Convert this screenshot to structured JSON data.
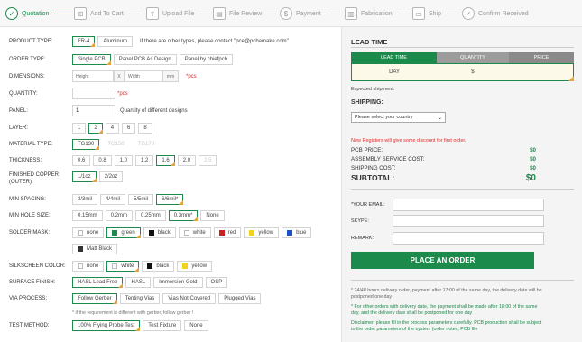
{
  "colors": {
    "brand": "#1b8a4b",
    "accent": "#e6a23c",
    "alert": "#e32b2b"
  },
  "steps": [
    {
      "label": "Quotation",
      "icon": "check-circle-icon",
      "active": true
    },
    {
      "label": "Add To Cart",
      "icon": "cart-icon",
      "active": false
    },
    {
      "label": "Upload File",
      "icon": "upload-icon",
      "active": false
    },
    {
      "label": "File Review",
      "icon": "file-icon",
      "active": false
    },
    {
      "label": "Payment",
      "icon": "dollar-icon",
      "active": false
    },
    {
      "label": "Fabrication",
      "icon": "factory-icon",
      "active": false
    },
    {
      "label": "Ship",
      "icon": "truck-icon",
      "active": false
    },
    {
      "label": "Confirm Received",
      "icon": "check-icon",
      "active": false
    }
  ],
  "form": {
    "product_type": {
      "label": "PRODUCT TYPE:",
      "options": [
        "FR-4",
        "Aluminum"
      ],
      "note": "If there are other types, please contact \"pce@pcbamake.com\""
    },
    "order_type": {
      "label": "ORDER TYPE:",
      "options": [
        "Single PCB",
        "Panel PCB As Design",
        "Panel by chiefpcb"
      ]
    },
    "dimensions": {
      "label": "DIMENSIONS:",
      "height_placeholder": "Height",
      "x": "X",
      "width_placeholder": "Width",
      "unit": "mm",
      "note": "*pcs"
    },
    "quantity": {
      "label": "QUANTITY:",
      "note": "*pcs"
    },
    "panel": {
      "label": "PANEL:",
      "value": "1",
      "note": "Quantity of different designs"
    },
    "layer": {
      "label": "LAYER:",
      "options": [
        "1",
        "2",
        "4",
        "6",
        "8"
      ]
    },
    "material_type": {
      "label": "MATERIAL TYPE:",
      "options": [
        "TG130",
        "TG150",
        "TG170"
      ]
    },
    "thickness": {
      "label": "THICKNESS:",
      "options": [
        "0.6",
        "0.8",
        "1.0",
        "1.2",
        "1.6",
        "2.0",
        "2.5"
      ]
    },
    "finished_copper": {
      "label": "FINISHED COPPER (OUTER):",
      "label1": "FINISHED COPPER",
      "label2": "(OUTER):",
      "options": [
        "1/1oz",
        "2/2oz"
      ]
    },
    "min_spacing": {
      "label": "MIN SPACING:",
      "options": [
        "3/3mil",
        "4/4mil",
        "5/5mil",
        "6/6mil*"
      ]
    },
    "min_hole_size": {
      "label": "MIN HOLE SIZE:",
      "options": [
        "0.15mm",
        "0.2mm",
        "0.25mm",
        "0.3mm*",
        "None"
      ]
    },
    "solder_mask": {
      "label": "SOLDER MASK:",
      "options": [
        {
          "name": "none",
          "color": "#ffffff"
        },
        {
          "name": "green",
          "color": "#1b8a4b"
        },
        {
          "name": "black",
          "color": "#111111"
        },
        {
          "name": "white",
          "color": "#ffffff"
        },
        {
          "name": "red",
          "color": "#cc1f1f"
        },
        {
          "name": "yellow",
          "color": "#f2d21b"
        },
        {
          "name": "blue",
          "color": "#1f4fcc"
        },
        {
          "name": "Matt Black",
          "color": "#333333"
        }
      ]
    },
    "silkscreen": {
      "label": "SILKSCREEN COLOR:",
      "options": [
        {
          "name": "none",
          "color": "#ffffff"
        },
        {
          "name": "white",
          "color": "#ffffff"
        },
        {
          "name": "black",
          "color": "#111111"
        },
        {
          "name": "yellow",
          "color": "#f2d21b"
        }
      ]
    },
    "surface_finish": {
      "label": "SURFACE FINISH:",
      "options": [
        "HASL Lead Free",
        "HASL",
        "Immersion Gold",
        "OSP"
      ]
    },
    "via_process": {
      "label": "VIA PROCESS:",
      "options": [
        "Follow Gerber",
        "Tenting Vias",
        "Vias Not Covered",
        "Plugged Vias"
      ],
      "note": "* if the requirement is different with gerber, follow gerber !"
    },
    "test_method": {
      "label": "TEST METHOD:",
      "options": [
        "100% Flying Probe Test",
        "Test Fixture",
        "None"
      ]
    }
  },
  "panel": {
    "lead_time_title": "LEAD TIME",
    "table_headers": [
      "LEAD TIME",
      "QUANTITY",
      "PRICE"
    ],
    "table_row": [
      "DAY",
      "$",
      ""
    ],
    "expected_shipment": "Expected shipment:",
    "shipping_title": "SHIPPING:",
    "country_select": "Please select your country",
    "promo": "New Registers will give some discount for first order.",
    "costs": [
      {
        "label": "PCB PRICE:",
        "value": "$0"
      },
      {
        "label": "ASSEMBLY SERVICE COST:",
        "value": "$0"
      },
      {
        "label": "SHIPPING COST:",
        "value": "$0"
      }
    ],
    "subtotal_label": "SUBTOTAL:",
    "subtotal_value": "$0",
    "fields": [
      {
        "label": "*YOUR EMAIL:"
      },
      {
        "label": "SKYPE:"
      },
      {
        "label": "REMARK:"
      }
    ],
    "order_button": "PLACE AN ORDER",
    "fine1": "* 24/48 hours delivery order, payment after 17:00 of the same day, the delivery date will be postponed one day",
    "fine2": "* For other orders with delivery date, the payment shall be made after 18:00 of the same day, and the delivery date shall be postponed for one day",
    "fine3": "Disclaimer: please fill in the process parameters carefully. PCB production shall be subject to the order parameters of the system (order notes, PCB file"
  }
}
